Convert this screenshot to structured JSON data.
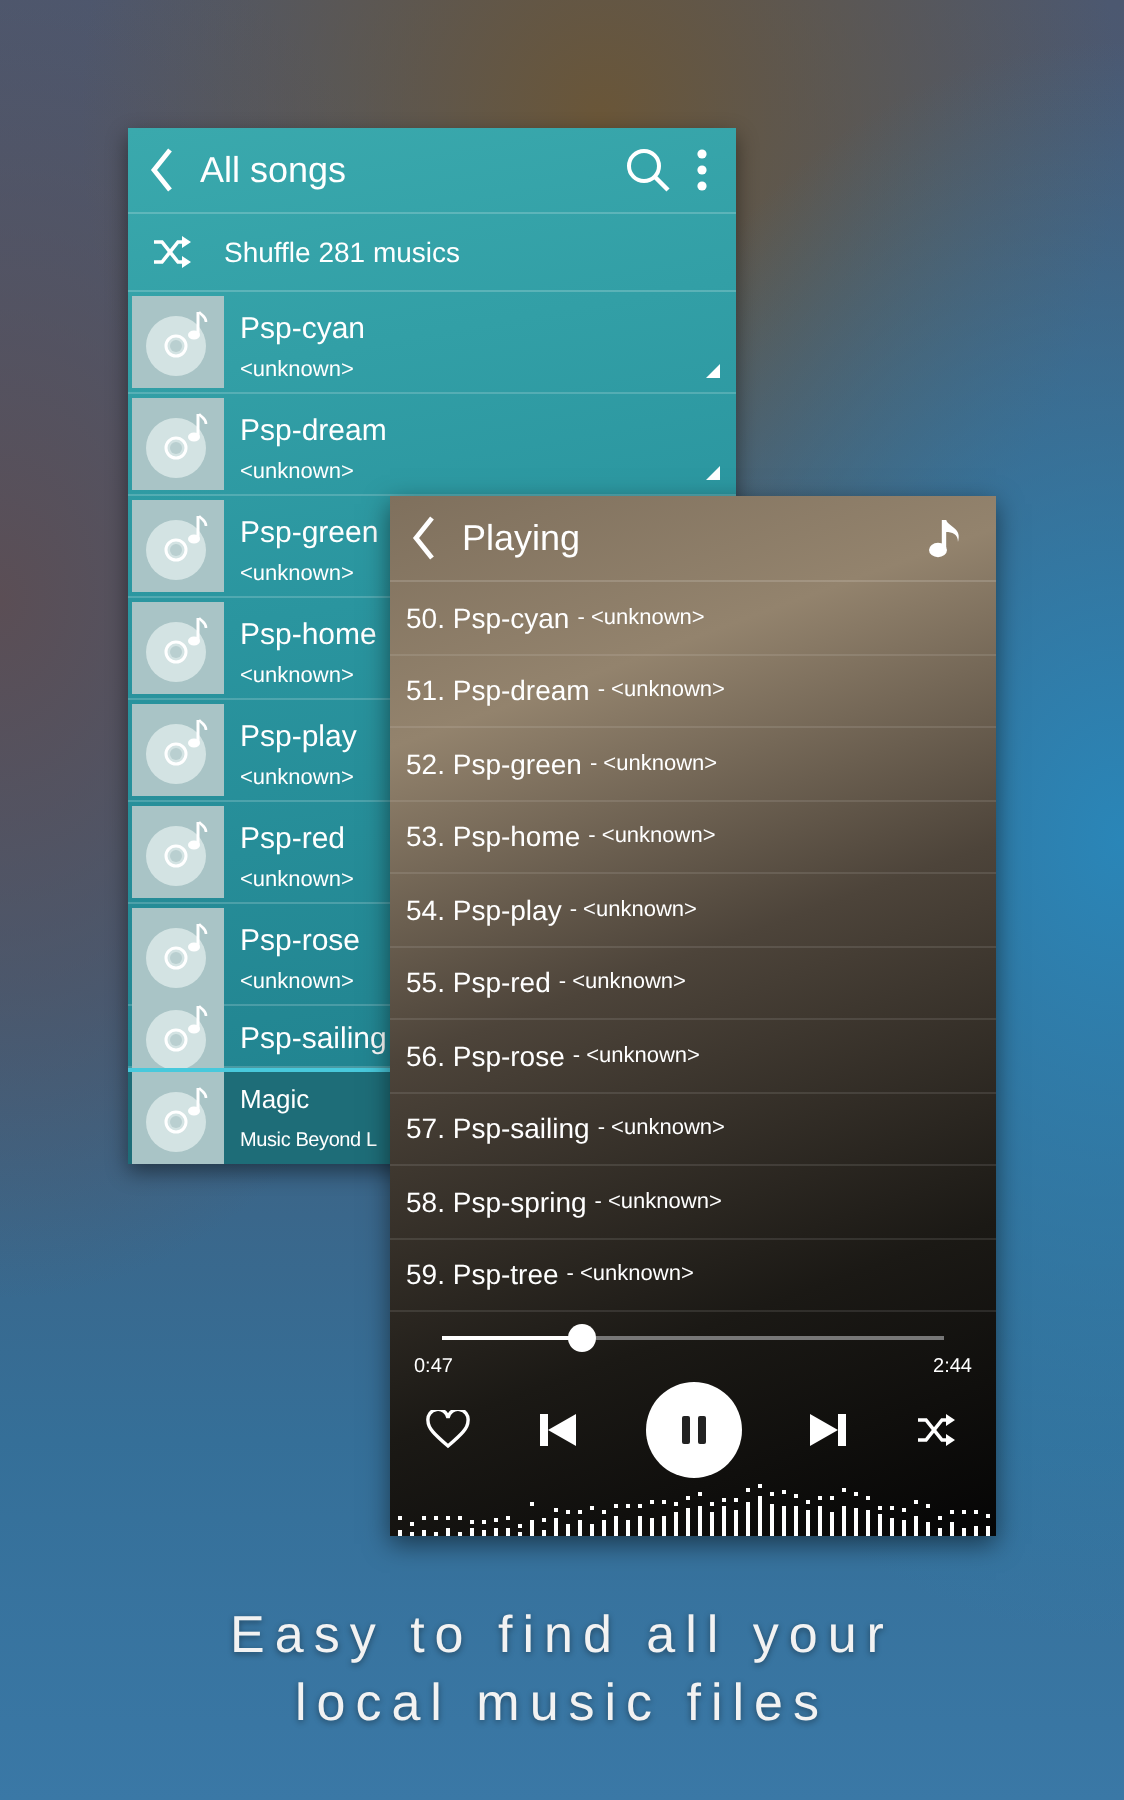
{
  "songs_card": {
    "title": "All songs",
    "shuffle_label": "Shuffle 281 musics",
    "songs": [
      {
        "title": "Psp-cyan",
        "artist": "<unknown>",
        "menu_mark": true
      },
      {
        "title": "Psp-dream",
        "artist": "<unknown>",
        "menu_mark": true
      },
      {
        "title": "Psp-green",
        "artist": "<unknown>",
        "menu_mark": false
      },
      {
        "title": "Psp-home",
        "artist": "<unknown>",
        "menu_mark": false
      },
      {
        "title": "Psp-play",
        "artist": "<unknown>",
        "menu_mark": false
      },
      {
        "title": "Psp-red",
        "artist": "<unknown>",
        "menu_mark": false
      },
      {
        "title": "Psp-rose",
        "artist": "<unknown>",
        "menu_mark": false
      },
      {
        "title": "Psp-sailing",
        "menu_mark": false
      }
    ],
    "now_playing": {
      "title": "Magic",
      "artist": "Music Beyond L"
    }
  },
  "playing_card": {
    "title": "Playing",
    "queue": [
      {
        "number": "50.",
        "title": "Psp-cyan",
        "artist": "- <unknown>"
      },
      {
        "number": "51.",
        "title": "Psp-dream",
        "artist": "- <unknown>"
      },
      {
        "number": "52.",
        "title": "Psp-green",
        "artist": "- <unknown>"
      },
      {
        "number": "53.",
        "title": "Psp-home",
        "artist": "- <unknown>"
      },
      {
        "number": "54.",
        "title": "Psp-play",
        "artist": "- <unknown>"
      },
      {
        "number": "55.",
        "title": "Psp-red",
        "artist": "- <unknown>"
      },
      {
        "number": "56.",
        "title": "Psp-rose",
        "artist": "- <unknown>"
      },
      {
        "number": "57.",
        "title": "Psp-sailing",
        "artist": "- <unknown>"
      },
      {
        "number": "58.",
        "title": "Psp-spring",
        "artist": "- <unknown>"
      },
      {
        "number": "59.",
        "title": "Psp-tree",
        "artist": "- <unknown>"
      }
    ],
    "progress": {
      "level": 0.28,
      "elapsed": "0:47",
      "duration": "2:44"
    },
    "playing": true
  },
  "caption": [
    "Easy to find all your",
    "local music files"
  ]
}
